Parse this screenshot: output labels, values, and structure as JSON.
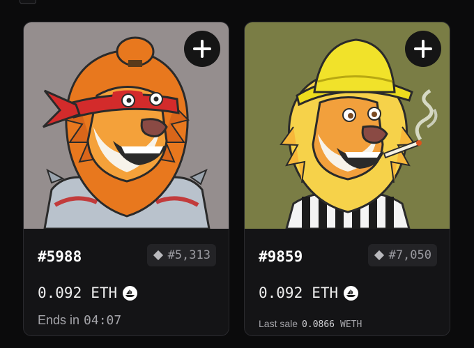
{
  "cards": [
    {
      "token_id": "#5988",
      "rank": "#5,313",
      "price": "0.092",
      "currency": "ETH",
      "status_label": "Ends in",
      "status_time": "04:07",
      "background_color": "#958e8e",
      "add_icon": "plus-icon",
      "rank_icon": "diamond-icon",
      "currency_icon": "opensea-icon"
    },
    {
      "token_id": "#9859",
      "rank": "#7,050",
      "price": "0.092",
      "currency": "ETH",
      "last_sale_label": "Last sale",
      "last_sale_value": "0.0866",
      "last_sale_unit": "WETH",
      "background_color": "#7a7d45",
      "add_icon": "plus-icon",
      "rank_icon": "diamond-icon",
      "currency_icon": "opensea-icon"
    }
  ]
}
